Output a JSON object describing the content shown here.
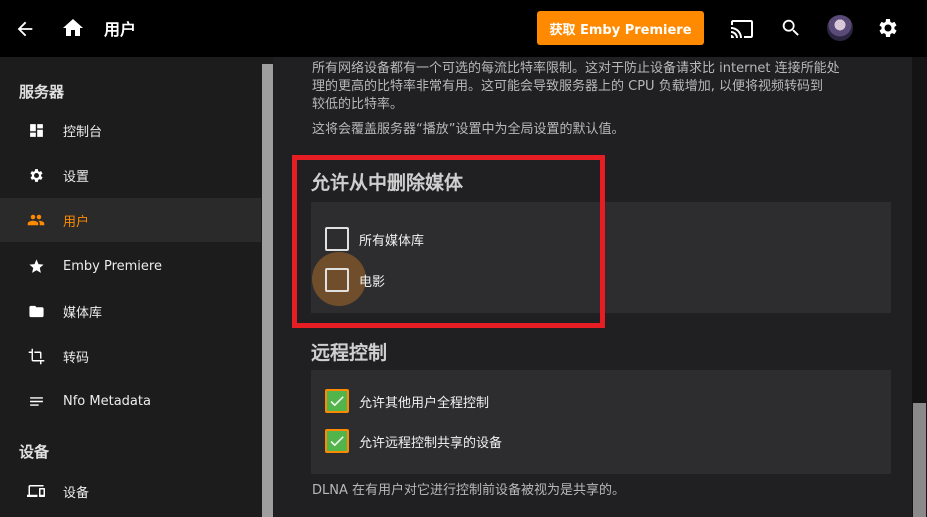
{
  "header": {
    "title": "用户",
    "premiere_button": "获取 Emby Premiere"
  },
  "sidebar": {
    "sections": [
      {
        "heading": "服务器",
        "items": [
          {
            "label": "控制台",
            "icon": "dashboard-icon"
          },
          {
            "label": "设置",
            "icon": "gear-icon"
          },
          {
            "label": "用户",
            "icon": "people-icon",
            "active": true
          },
          {
            "label": "Emby Premiere",
            "icon": "star-icon"
          },
          {
            "label": "媒体库",
            "icon": "folder-icon"
          },
          {
            "label": "转码",
            "icon": "crop-icon"
          },
          {
            "label": "Nfo Metadata",
            "icon": "notes-icon"
          }
        ]
      },
      {
        "heading": "设备",
        "items": [
          {
            "label": "设备",
            "icon": "devices-icon"
          }
        ]
      }
    ]
  },
  "main": {
    "bitrate_desc_1": "所有网络设备都有一个可选的每流比特率限制。这对于防止设备请求比 internet 连接所能处",
    "bitrate_desc_2": "理的更高的比特率非常有用。这可能会导致服务器上的 CPU 负载增加, 以便将视频转码到",
    "bitrate_desc_3": "较低的比特率。",
    "bitrate_desc_4": "这将会覆盖服务器“播放”设置中为全局设置的默认值。",
    "delete_media": {
      "title": "允许从中删除媒体",
      "options": [
        {
          "label": "所有媒体库",
          "checked": false
        },
        {
          "label": "电影",
          "checked": false
        }
      ]
    },
    "remote_control": {
      "title": "远程控制",
      "options": [
        {
          "label": "允许其他用户全程控制",
          "checked": true
        },
        {
          "label": "允许远程控制共享的设备",
          "checked": true
        }
      ],
      "note": "DLNA 在有用户对它进行控制前设备被视为是共享的。"
    }
  },
  "colors": {
    "accent": "#ff8a00",
    "check_green": "#52b54b",
    "highlight_red": "#e61e24"
  }
}
